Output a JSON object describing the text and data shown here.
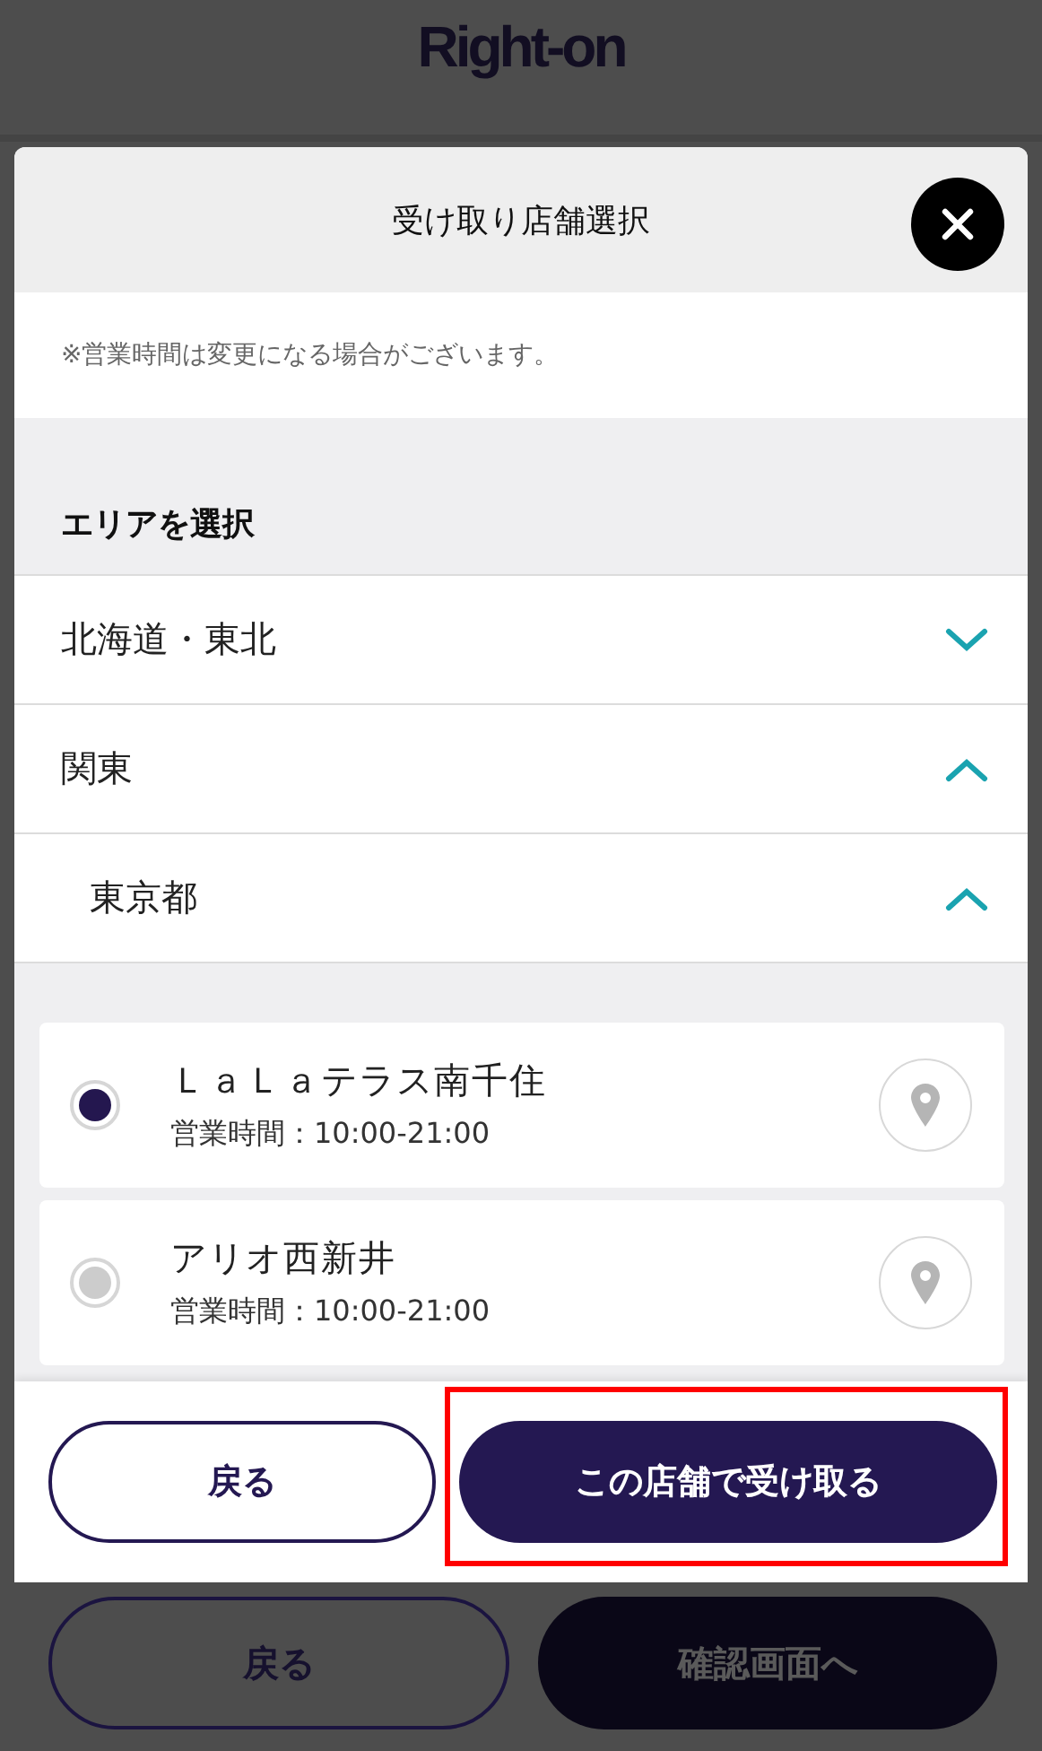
{
  "logo": "Right-on",
  "background_buttons": [
    {
      "label": "戻る",
      "kind": "outline"
    },
    {
      "label": "確認画面へ",
      "kind": "filled"
    }
  ],
  "modal": {
    "title": "受け取り店舗選択",
    "notice": "※営業時間は変更になる場合がございます。",
    "area_heading": "エリアを選択",
    "areas": [
      {
        "name": "北海道・東北",
        "expanded": false
      },
      {
        "name": "関東",
        "expanded": true,
        "children": [
          {
            "name": "東京都",
            "expanded": true
          }
        ]
      }
    ],
    "stores": [
      {
        "name": "ＬａＬａテラス南千住",
        "hours": "営業時間：10:00-21:00",
        "selected": true
      },
      {
        "name": "アリオ西新井",
        "hours": "営業時間：10:00-21:00",
        "selected": false
      }
    ],
    "buttons": [
      {
        "label": "戻る",
        "kind": "outline",
        "highlighted": false
      },
      {
        "label": "この店舗で受け取る",
        "kind": "filled",
        "highlighted": true
      }
    ]
  }
}
